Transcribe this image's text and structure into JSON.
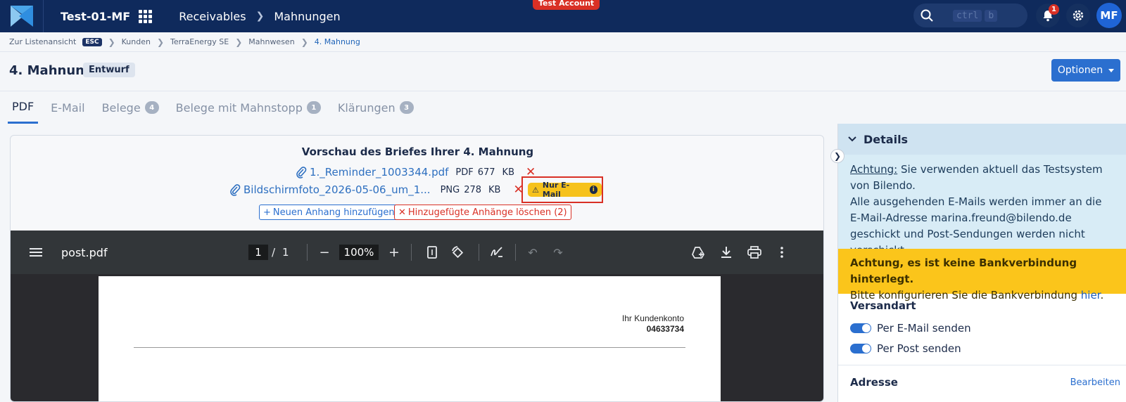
{
  "topbar": {
    "tenant": "Test-01-MF",
    "nav": [
      "Receivables",
      "Mahnungen"
    ],
    "test_badge": "Test Account",
    "search_shortcut": [
      "ctrl",
      "b"
    ],
    "notification_count": "1",
    "avatar_initials": "MF",
    "bg_color": "#0f2a5c"
  },
  "breadcrumb": {
    "back": "Zur Listenansicht",
    "esc": "ESC",
    "items": [
      "Kunden",
      "TerraEnergy SE",
      "Mahnwesen",
      "4. Mahnung"
    ]
  },
  "header": {
    "title": "4. Mahnung",
    "status": "Entwurf",
    "options_label": "Optionen"
  },
  "tabs": [
    {
      "label": "PDF",
      "count": null,
      "active": true
    },
    {
      "label": "E-Mail",
      "count": null
    },
    {
      "label": "Belege",
      "count": "4"
    },
    {
      "label": "Belege mit Mahnstopp",
      "count": "1"
    },
    {
      "label": "Klärungen",
      "count": "3"
    }
  ],
  "preview": {
    "title": "Vorschau des Briefes Ihrer 4. Mahnung",
    "attachments": [
      {
        "name": "1._Reminder_1003344.pdf",
        "type": "PDF",
        "size": "677",
        "unit": "KB"
      },
      {
        "name": "Bildschirmfoto_2026-05-06_um_1...",
        "type": "PNG",
        "size": "278",
        "unit": "KB",
        "badge": "Nur E-Mail"
      }
    ],
    "add_attachment": "Neuen Anhang hinzufügen",
    "delete_attachments": "Hinzugefügte Anhänge löschen (2)"
  },
  "pdf_viewer": {
    "filename": "post.pdf",
    "page_current": "1",
    "page_sep": "/",
    "page_total": "1",
    "zoom": "100%",
    "doc": {
      "account_label": "Ihr Kundenkonto",
      "account_number": "04633734"
    }
  },
  "details": {
    "heading": "Details",
    "info_prefix": "Achtung:",
    "info_text": " Sie verwenden aktuell das Testsystem von Bilendo.",
    "info_text2": "Alle ausgehenden E-Mails werden immer an die E-Mail-Adresse marina.freund@bilendo.de geschickt und Post-Sendungen werden nicht verschickt.",
    "warn_title": "Achtung, es ist keine Bankverbindung hinterlegt.",
    "warn_text": "Bitte konfigurieren Sie die Bankverbindung ",
    "warn_link": "hier",
    "warn_end": ".",
    "shipping_title": "Versandart",
    "shipping_email": "Per E-Mail senden",
    "shipping_post": "Per Post senden",
    "address_title": "Adresse",
    "address_edit": "Bearbeiten"
  }
}
